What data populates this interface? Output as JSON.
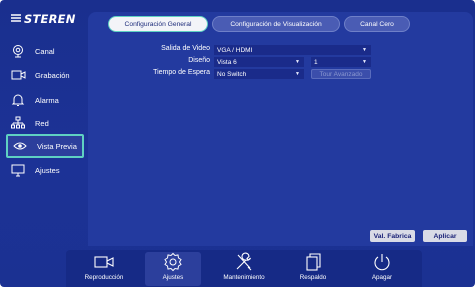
{
  "brand": {
    "name": "STEREN"
  },
  "sidebar": {
    "items": [
      {
        "label": "Canal",
        "icon": "camera-icon"
      },
      {
        "label": "Grabación",
        "icon": "recording-icon"
      },
      {
        "label": "Alarma",
        "icon": "bell-icon"
      },
      {
        "label": "Red",
        "icon": "network-icon"
      },
      {
        "label": "Vista Previa",
        "icon": "eye-icon",
        "active": true
      },
      {
        "label": "Ajustes",
        "icon": "monitor-icon"
      }
    ]
  },
  "tabs": [
    {
      "label": "Configuración General",
      "active": true
    },
    {
      "label": "Configuración de Visualización"
    },
    {
      "label": "Canal Cero"
    }
  ],
  "form": {
    "video_output": {
      "label": "Salida de Video",
      "value": "VGA / HDMI"
    },
    "layout": {
      "label": "Diseño",
      "value": "Vista 6",
      "secondary_value": "1"
    },
    "dwell_time": {
      "label": "Tiempo de Espera",
      "value": "No Switch"
    },
    "tour_button": "Tour Avanzado"
  },
  "actions": {
    "factory": "Val. Fabrica",
    "apply": "Aplicar"
  },
  "bottom_bar": {
    "items": [
      {
        "label": "Reproducción",
        "icon": "video-camera-icon"
      },
      {
        "label": "Ajustes",
        "icon": "gear-icon",
        "active": true
      },
      {
        "label": "Mantenimiento",
        "icon": "tools-icon"
      },
      {
        "label": "Respaldo",
        "icon": "backup-icon"
      },
      {
        "label": "Apagar",
        "icon": "power-icon"
      }
    ]
  },
  "colors": {
    "background": "#1c3296",
    "panel": "#233a9f",
    "highlight": "#5fd1c2",
    "select_bg": "#1a2b8a"
  }
}
